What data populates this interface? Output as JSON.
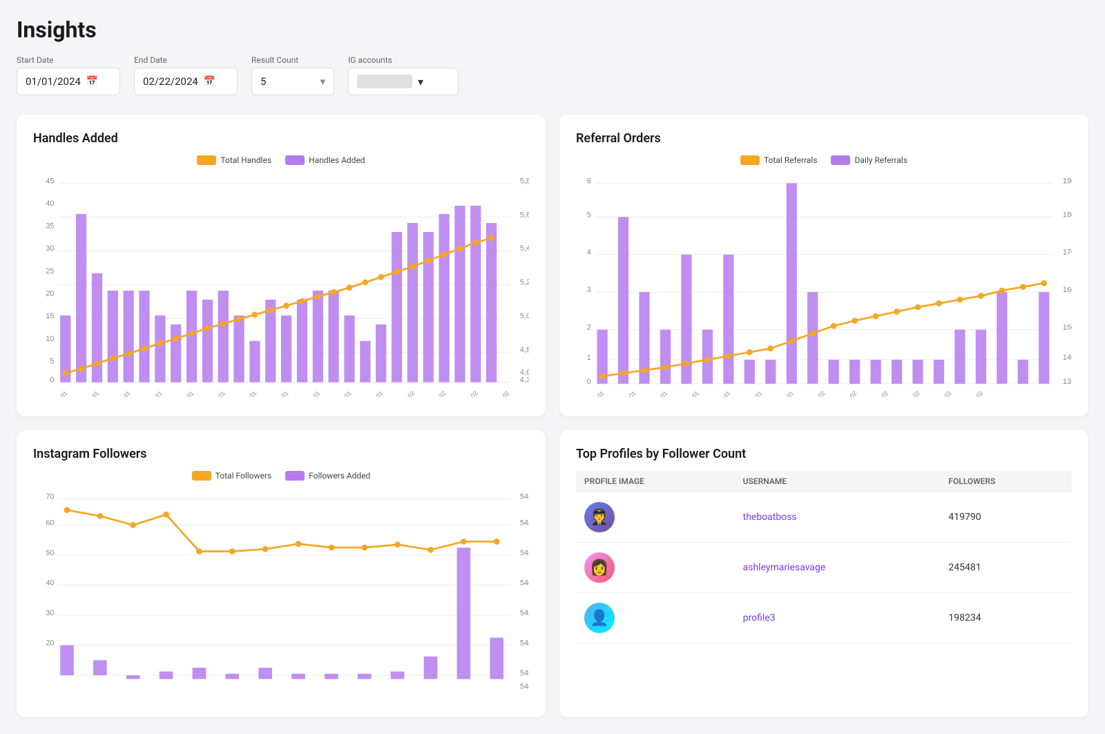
{
  "page": {
    "title": "Insights"
  },
  "filters": {
    "start_date_label": "Start Date",
    "start_date_value": "01/01/2024",
    "end_date_label": "End Date",
    "end_date_value": "02/22/2024",
    "result_count_label": "Result Count",
    "result_count_value": "5",
    "ig_accounts_label": "IG accounts"
  },
  "handles_chart": {
    "title": "Handles Added",
    "legend_total": "Total Handles",
    "legend_added": "Handles Added",
    "color_total": "#f5a623",
    "color_added": "#b57bee"
  },
  "referral_chart": {
    "title": "Referral Orders",
    "legend_total": "Total Referrals",
    "legend_daily": "Daily Referrals",
    "color_total": "#f5a623",
    "color_daily": "#b57bee"
  },
  "followers_chart": {
    "title": "Instagram Followers",
    "legend_total": "Total Followers",
    "legend_added": "Followers Added",
    "color_total": "#f5a623",
    "color_added": "#b57bee"
  },
  "top_profiles": {
    "title": "Top Profiles by Follower Count",
    "col_image": "PROFILE IMAGE",
    "col_username": "USERNAME",
    "col_followers": "FOLLOWERS",
    "rows": [
      {
        "username": "theboatboss",
        "followers": "419790"
      },
      {
        "username": "ashleymariesavage",
        "followers": "245481"
      },
      {
        "username": "profile3",
        "followers": "198234"
      }
    ]
  }
}
